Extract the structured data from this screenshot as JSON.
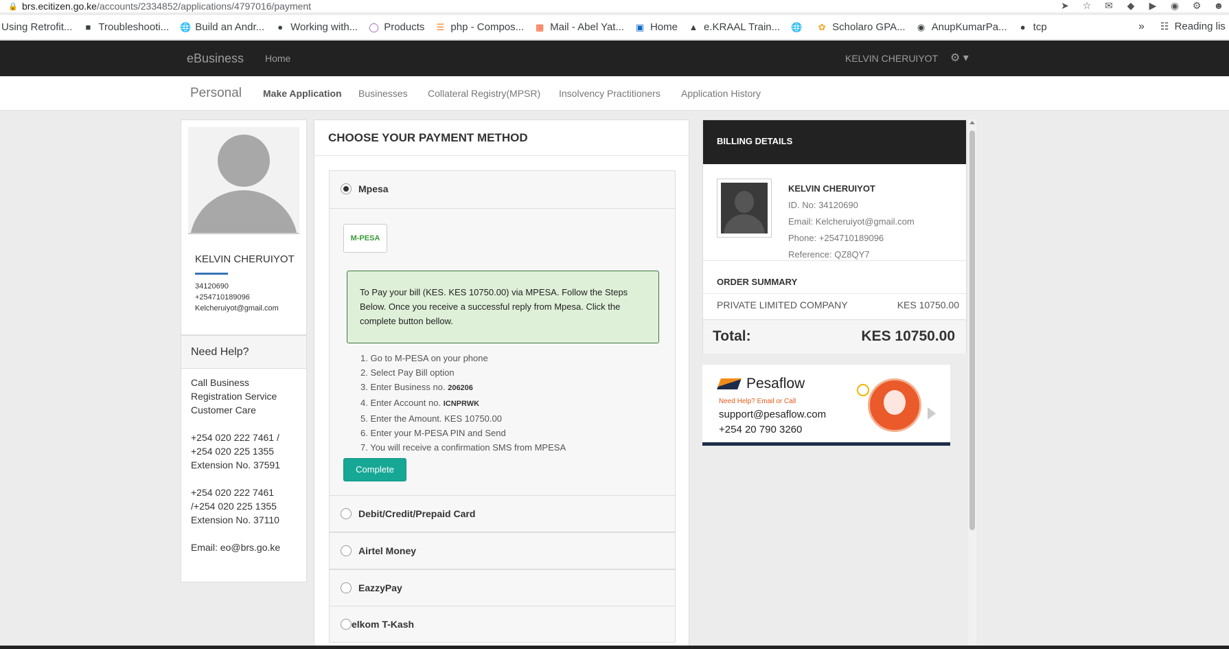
{
  "browser": {
    "url_host": "brs.ecitizen.go.ke",
    "url_path": "/accounts/2334852/applications/4797016/payment",
    "bookmarks": [
      {
        "label": "Using Retrofit...",
        "icon": "page-icon"
      },
      {
        "label": "Troubleshooti...",
        "icon": "site-icon"
      },
      {
        "label": "Build an Andr...",
        "icon": "globe-icon"
      },
      {
        "label": "Working with...",
        "icon": "medium-icon"
      },
      {
        "label": "Products",
        "icon": "circle-icon"
      },
      {
        "label": "php - Compos...",
        "icon": "stackoverflow-icon"
      },
      {
        "label": "Mail - Abel Yat...",
        "icon": "microsoft-icon"
      },
      {
        "label": "Home",
        "icon": "linkedin-icon"
      },
      {
        "label": "e.KRAAL Train...",
        "icon": "site-icon"
      },
      {
        "label": "",
        "icon": "globe-icon"
      },
      {
        "label": "Scholaro GPA...",
        "icon": "site-icon"
      },
      {
        "label": "AnupKumarPa...",
        "icon": "github-icon"
      },
      {
        "label": "tcp",
        "icon": "medium-icon"
      }
    ],
    "more": "»",
    "reading_list": "Reading lis"
  },
  "navbar": {
    "brand": "eBusiness",
    "home": "Home",
    "user": "KELVIN CHERUIYOT"
  },
  "subnav": {
    "title": "Personal",
    "items": [
      "Make Application",
      "Businesses",
      "Collateral Registry(MPSR)",
      "Insolvency Practitioners",
      "Application History"
    ]
  },
  "profile": {
    "name": "KELVIN CHERUIYOT",
    "id": "34120690",
    "phone": "+254710189096",
    "email": "Kelcheruiyot@gmail.com"
  },
  "help": {
    "title": "Need Help?",
    "intro": "Call Business Registration Service Customer Care",
    "block1": [
      "+254 020 222 7461 /",
      "+254 020 225 1355",
      "Extension No. 37591"
    ],
    "block2": [
      "+254 020 222 7461",
      "/+254 020 225 1355",
      "Extension No. 37110"
    ],
    "email": "Email: eo@brs.go.ke"
  },
  "payment": {
    "title": "CHOOSE YOUR PAYMENT METHOD",
    "methods": [
      "Mpesa",
      "Debit/Credit/Prepaid Card",
      "Airtel Money",
      "EazzyPay",
      "elkom T-Kash"
    ],
    "selected": "Mpesa",
    "logo_text": "M-PESA",
    "notice": "To Pay your bill (KES. KES 10750.00) via MPESA. Follow the Steps Below. Once you receive a successful reply from Mpesa. Click the complete button bellow.",
    "steps": {
      "s1": "1. Go to M-PESA on your phone",
      "s2": "2. Select Pay Bill option",
      "s3": "3. Enter Business no.",
      "s3_val": "206206",
      "s4": "4. Enter Account no.",
      "s4_val": "ICNPRWK",
      "s5": "5. Enter the Amount. KES 10750.00",
      "s6": "6. Enter your M-PESA PIN and Send",
      "s7": "7. You will receive a confirmation SMS from MPESA"
    },
    "complete_label": "Complete"
  },
  "billing": {
    "title": "BILLING DETAILS",
    "name": "KELVIN CHERUIYOT",
    "id": "ID. No: 34120690",
    "email": "Email: Kelcheruiyot@gmail.com",
    "phone": "Phone: +254710189096",
    "reference": "Reference: QZ8QY7",
    "order_summary": "ORDER SUMMARY",
    "item": "PRIVATE LIMITED COMPANY",
    "item_amount": "KES 10750.00",
    "total_label": "Total:",
    "total_amount": "KES 10750.00"
  },
  "pesaflow": {
    "brand": "Pesaflow",
    "need_help": "Need Help? Email or Call",
    "email": "support@pesaflow.com",
    "phone": "+254 20 790 3260"
  }
}
